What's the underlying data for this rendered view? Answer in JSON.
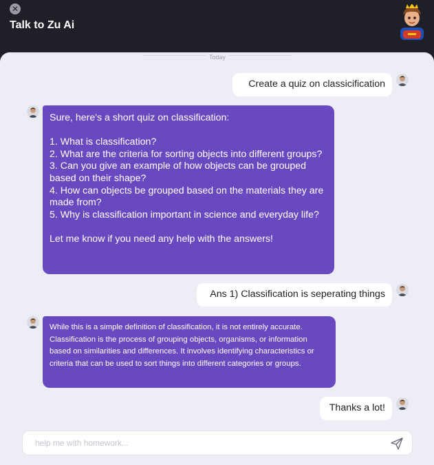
{
  "header": {
    "title": "Talk to Zu Ai",
    "close_glyph": "✕"
  },
  "chat": {
    "date_label": "Today",
    "messages": [
      {
        "role": "user",
        "text": "Create a quiz on classicification"
      },
      {
        "role": "bot",
        "text": "Sure, here's a short quiz on classification:\n\n1. What is classification?\n2. What are the criteria for sorting objects into different groups?\n3. Can you give an example of how objects can be grouped based on their shape?\n4. How can objects be grouped based on the materials they are made from?\n5. Why is classification important in science and everyday life?\n\nLet me know if you need any help with the answers!"
      },
      {
        "role": "user",
        "text": "Ans 1) Classification is seperating things"
      },
      {
        "role": "bot",
        "text": "While this is a simple definition of classification, it is not entirely accurate. Classification is the process of grouping objects, organisms, or information based on similarities and differences. It involves identifying characteristics or criteria that can be used to sort things into different categories or groups."
      },
      {
        "role": "user",
        "text": "Thanks a lot!"
      }
    ]
  },
  "composer": {
    "placeholder": "help me with homework...",
    "value": ""
  },
  "colors": {
    "header_bg": "#1e1f27",
    "panel_bg": "#ecedf5",
    "bot_bubble": "#6849c0",
    "user_bubble": "#ffffff"
  },
  "icons": {
    "close": "close-icon",
    "send": "send-icon",
    "bot_avatar": "bot-avatar-icon",
    "user_avatar": "user-avatar-icon"
  }
}
